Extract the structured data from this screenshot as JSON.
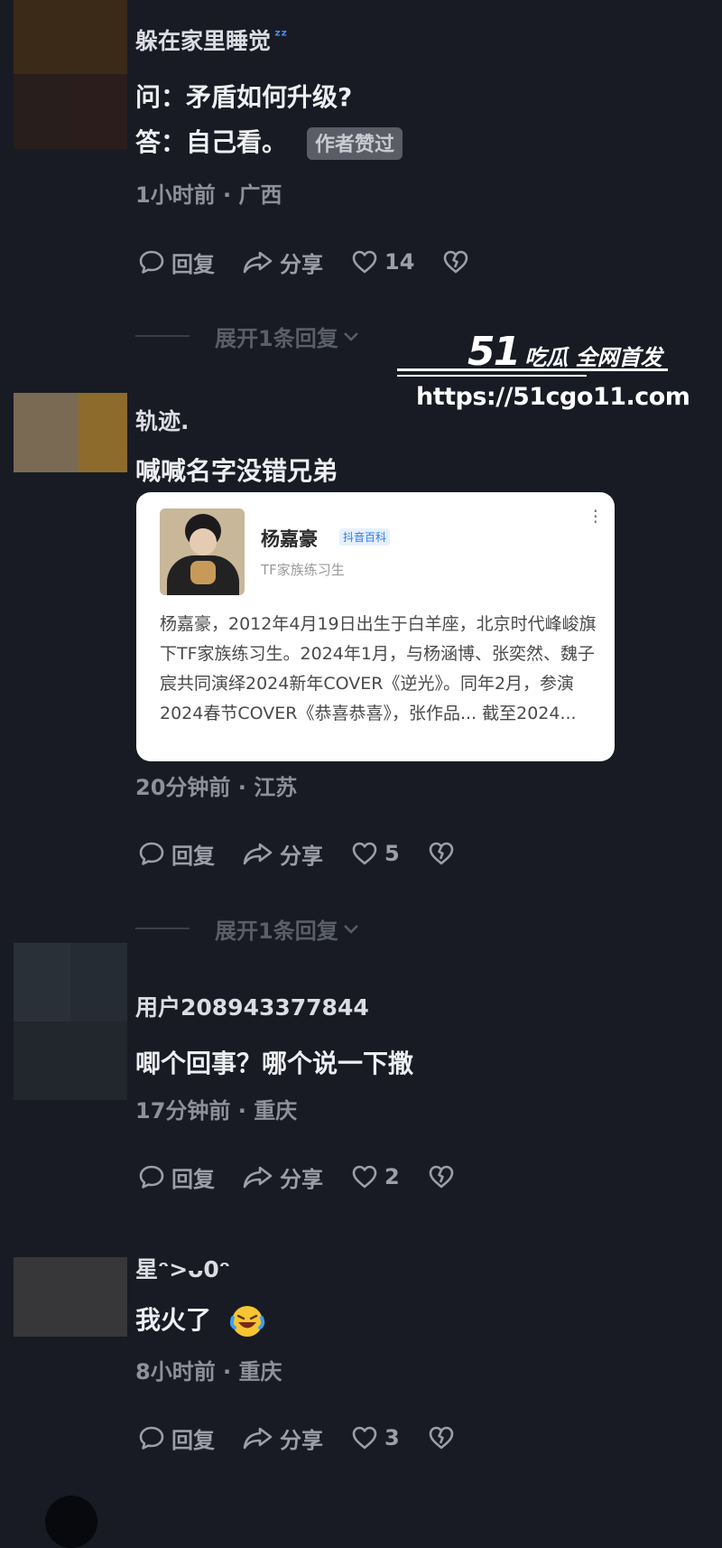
{
  "comments": [
    {
      "username": "躲在家里睡觉",
      "username_emoji": "ᶻᶻ",
      "lines": [
        "问：矛盾如何升级?",
        "答：自己看。"
      ],
      "badge": "作者赞过",
      "meta": "1小时前 · 广西",
      "actions": {
        "reply": "回复",
        "share": "分享",
        "likes": "14"
      },
      "expand": "展开1条回复"
    },
    {
      "username": "轨迹.",
      "lines": [
        "喊喊名字没错兄弟"
      ],
      "card": {
        "name": "杨嘉豪",
        "tag": "抖音百科",
        "subtitle": "TF家族练习生",
        "body": "杨嘉豪，2012年4月19日出生于白羊座，北京时代峰峻旗下TF家族练习生。2024年1月，与杨涵博、张奕然、魏子宸共同演绎2024新年COVER《逆光》。同年2月，参演2024春节COVER《恭喜恭喜》，张作品... 截至2024..."
      },
      "meta": "20分钟前 · 江苏",
      "actions": {
        "reply": "回复",
        "share": "分享",
        "likes": "5"
      },
      "expand": "展开1条回复"
    },
    {
      "username": "用户208943377844",
      "lines": [
        "唧个回事？哪个说一下撒"
      ],
      "meta": "17分钟前 · 重庆",
      "actions": {
        "reply": "回复",
        "share": "分享",
        "likes": "2"
      }
    },
    {
      "username": "星ᵔ>ᴗ0ᵔ",
      "lines": [
        "我火了"
      ],
      "emoji": "laughing-tears-emoji",
      "meta": "8小时前 · 重庆",
      "actions": {
        "reply": "回复",
        "share": "分享",
        "likes": "3"
      }
    }
  ],
  "watermark": {
    "brand_number": "51",
    "brand_text": "吃瓜 全网首发",
    "url": "https://51cgo11.com"
  },
  "colors": {
    "background": "#181b24",
    "text_primary": "#eeeff3",
    "text_muted": "#8e909a",
    "icon": "#9c9ea8",
    "expand": "#5b5e68",
    "badge_bg": "#5a5d66",
    "tag_blue": "#2f7bf0"
  }
}
